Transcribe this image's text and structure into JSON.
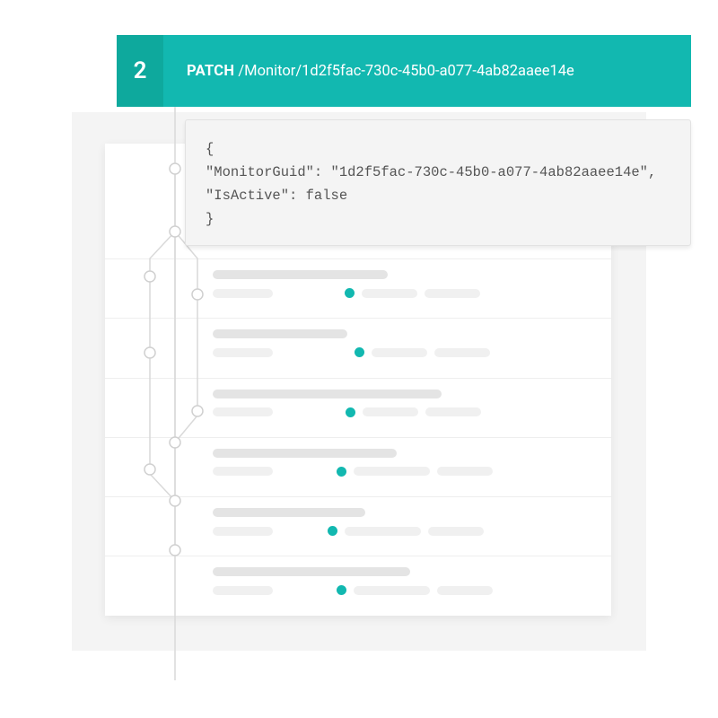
{
  "step": {
    "number": "2",
    "method": "PATCH",
    "path": "/Monitor/1d2f5fac-730c-45b0-a077-4ab82aaee14e"
  },
  "code_block": "{\n\"MonitorGuid\": \"1d2f5fac-730c-45b0-a077-4ab82aaee14e\",\n\"IsActive\": false\n}"
}
